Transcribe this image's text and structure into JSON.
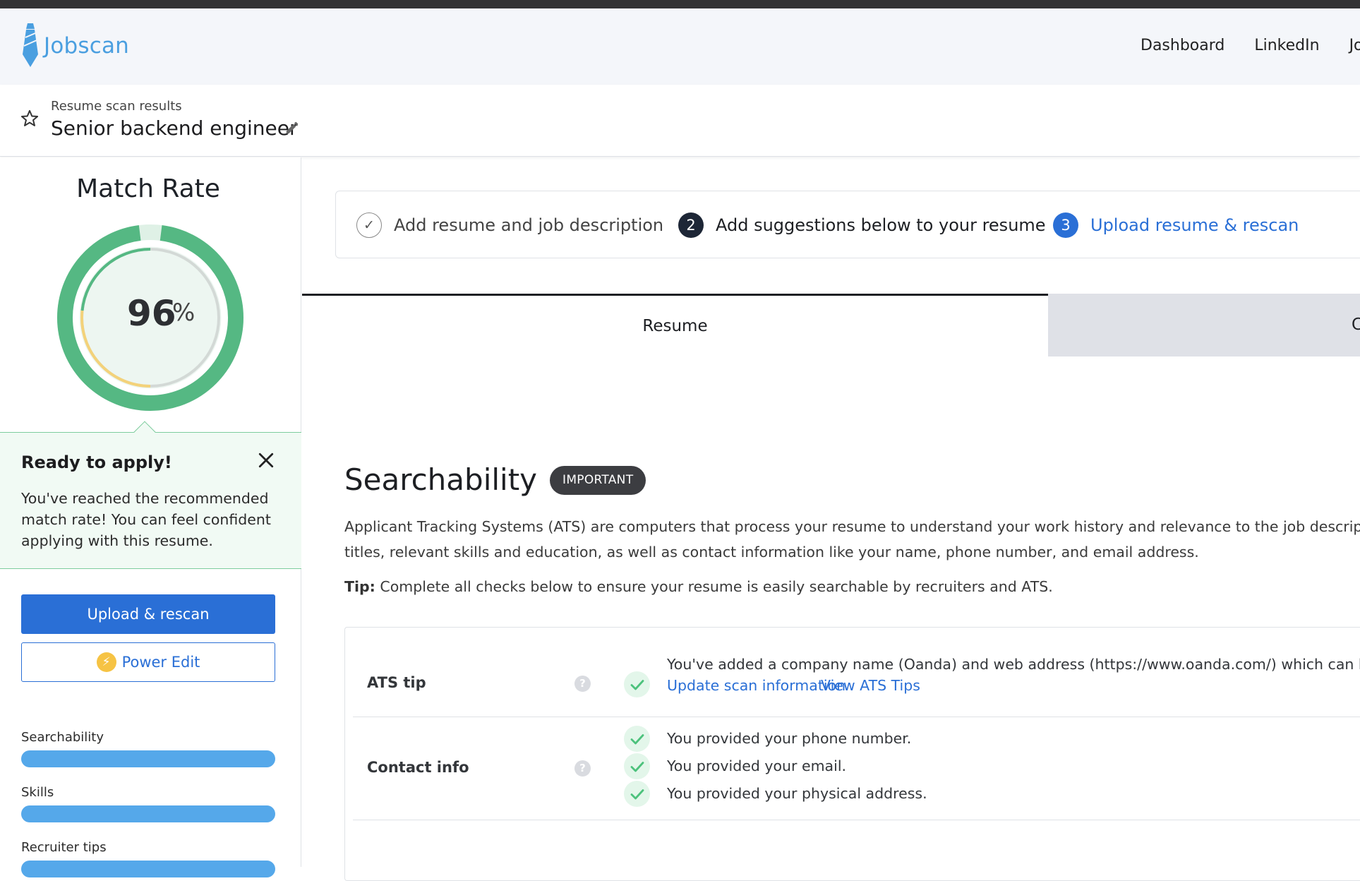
{
  "app": {
    "name": "Jobscan"
  },
  "nav": {
    "links": [
      "Dashboard",
      "LinkedIn",
      "Jobs"
    ]
  },
  "header": {
    "breadcrumb": "Resume scan results",
    "scan_title": "Senior backend engineer"
  },
  "match_rate": {
    "title": "Match Rate",
    "value": 96,
    "value_label": "96",
    "unit": "%"
  },
  "ready": {
    "title": "Ready to apply!",
    "text": "You've reached the recommended match rate! You can feel confident applying with this resume."
  },
  "buttons": {
    "upload": "Upload & rescan",
    "power_edit": "Power Edit"
  },
  "categories": [
    {
      "label": "Searchability",
      "progress": 1.0
    },
    {
      "label": "Skills",
      "progress": 1.0
    },
    {
      "label": "Recruiter tips",
      "progress": 1.0
    }
  ],
  "steps": [
    {
      "label": "Add resume and job description",
      "marker": "✓",
      "state": "done"
    },
    {
      "label": "Add suggestions below to your resume",
      "marker": "2",
      "state": "current"
    },
    {
      "label": "Upload resume & rescan",
      "marker": "3",
      "state": "next"
    }
  ],
  "tabs": {
    "resume": "Resume",
    "other": "C"
  },
  "section": {
    "title": "Searchability",
    "badge": "IMPORTANT",
    "desc_line1": "Applicant Tracking Systems (ATS) are computers that process your resume to understand your work history and relevance to the job description. Th",
    "desc_line2": "titles, relevant skills and education, as well as contact information like your name, phone number, and email address.",
    "tip_label": "Tip:",
    "tip_text": "Complete all checks below to ensure your resume is easily searchable by recruiters and ATS."
  },
  "checks": {
    "ats": {
      "label": "ATS tip",
      "text": "You've added a company name (Oanda) and web address (https://www.oanda.com/) which can help u",
      "link1": "Update scan information",
      "link2": "View ATS Tips"
    },
    "contact": {
      "label": "Contact info",
      "items": [
        "You provided your phone number.",
        "You provided your email.",
        "You provided your physical address."
      ]
    },
    "help_glyph": "?"
  },
  "colors": {
    "accent": "#2a6fd6",
    "gauge_green": "#55b883",
    "gauge_yellow": "#f3d27a",
    "bar_blue": "#55a8ea",
    "success_bg": "#f1faf4"
  },
  "icons": {
    "logo": "tie-logo-icon",
    "star": "star-icon",
    "edit": "pencil-icon",
    "close": "close-icon",
    "bolt": "lightning-bolt-icon",
    "check": "check-icon",
    "help": "help-icon"
  }
}
